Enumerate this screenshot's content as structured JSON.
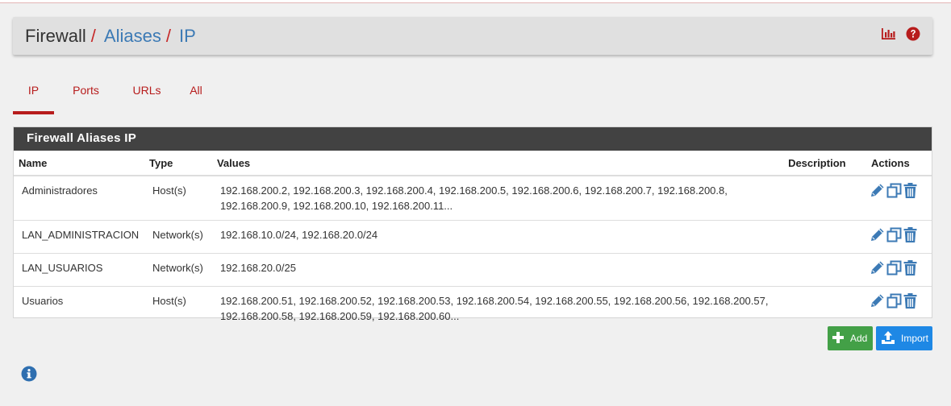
{
  "breadcrumb": {
    "first": "Firewall",
    "second": "Aliases",
    "third": "IP",
    "separator": "/"
  },
  "tabs": [
    {
      "label": "IP",
      "active": true
    },
    {
      "label": "Ports",
      "active": false
    },
    {
      "label": "URLs",
      "active": false
    },
    {
      "label": "All",
      "active": false
    }
  ],
  "panel": {
    "title": "Firewall Aliases IP",
    "columns": {
      "name": "Name",
      "type": "Type",
      "values": "Values",
      "description": "Description",
      "actions": "Actions"
    },
    "rows": [
      {
        "name": "Administradores",
        "type": "Host(s)",
        "values": "192.168.200.2, 192.168.200.3, 192.168.200.4, 192.168.200.5, 192.168.200.6, 192.168.200.7, 192.168.200.8, 192.168.200.9, 192.168.200.10, 192.168.200.11...",
        "description": ""
      },
      {
        "name": "LAN_ADMINISTRACION",
        "type": "Network(s)",
        "values": "192.168.10.0/24, 192.168.20.0/24",
        "description": ""
      },
      {
        "name": "LAN_USUARIOS",
        "type": "Network(s)",
        "values": "192.168.20.0/25",
        "description": ""
      },
      {
        "name": "Usuarios",
        "type": "Host(s)",
        "values": "192.168.200.51, 192.168.200.52, 192.168.200.53, 192.168.200.54, 192.168.200.55, 192.168.200.56, 192.168.200.57, 192.168.200.58, 192.168.200.59, 192.168.200.60...",
        "description": ""
      }
    ]
  },
  "buttons": {
    "add": "Add",
    "import": "Import"
  },
  "icons": {
    "chart": "bar-chart-icon",
    "help": "question-circle-icon",
    "edit": "pencil-icon",
    "copy": "clone-icon",
    "delete": "trash-icon",
    "add": "plus-icon",
    "import": "upload-icon",
    "info": "info-circle-icon"
  },
  "colors": {
    "accent_red": "#b71c1c",
    "link_blue": "#3c7ab5",
    "panel_heading": "#424242",
    "add_green": "#43a047",
    "import_blue": "#1e88e5",
    "action_blue": "#3c7ab5"
  }
}
